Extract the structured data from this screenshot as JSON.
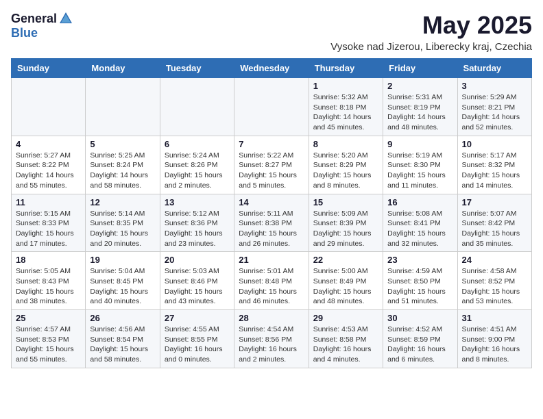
{
  "header": {
    "logo_general": "General",
    "logo_blue": "Blue",
    "month_title": "May 2025",
    "location": "Vysoke nad Jizerou, Liberecky kraj, Czechia"
  },
  "days_of_week": [
    "Sunday",
    "Monday",
    "Tuesday",
    "Wednesday",
    "Thursday",
    "Friday",
    "Saturday"
  ],
  "weeks": [
    [
      {
        "num": "",
        "detail": ""
      },
      {
        "num": "",
        "detail": ""
      },
      {
        "num": "",
        "detail": ""
      },
      {
        "num": "",
        "detail": ""
      },
      {
        "num": "1",
        "detail": "Sunrise: 5:32 AM\nSunset: 8:18 PM\nDaylight: 14 hours\nand 45 minutes."
      },
      {
        "num": "2",
        "detail": "Sunrise: 5:31 AM\nSunset: 8:19 PM\nDaylight: 14 hours\nand 48 minutes."
      },
      {
        "num": "3",
        "detail": "Sunrise: 5:29 AM\nSunset: 8:21 PM\nDaylight: 14 hours\nand 52 minutes."
      }
    ],
    [
      {
        "num": "4",
        "detail": "Sunrise: 5:27 AM\nSunset: 8:22 PM\nDaylight: 14 hours\nand 55 minutes."
      },
      {
        "num": "5",
        "detail": "Sunrise: 5:25 AM\nSunset: 8:24 PM\nDaylight: 14 hours\nand 58 minutes."
      },
      {
        "num": "6",
        "detail": "Sunrise: 5:24 AM\nSunset: 8:26 PM\nDaylight: 15 hours\nand 2 minutes."
      },
      {
        "num": "7",
        "detail": "Sunrise: 5:22 AM\nSunset: 8:27 PM\nDaylight: 15 hours\nand 5 minutes."
      },
      {
        "num": "8",
        "detail": "Sunrise: 5:20 AM\nSunset: 8:29 PM\nDaylight: 15 hours\nand 8 minutes."
      },
      {
        "num": "9",
        "detail": "Sunrise: 5:19 AM\nSunset: 8:30 PM\nDaylight: 15 hours\nand 11 minutes."
      },
      {
        "num": "10",
        "detail": "Sunrise: 5:17 AM\nSunset: 8:32 PM\nDaylight: 15 hours\nand 14 minutes."
      }
    ],
    [
      {
        "num": "11",
        "detail": "Sunrise: 5:15 AM\nSunset: 8:33 PM\nDaylight: 15 hours\nand 17 minutes."
      },
      {
        "num": "12",
        "detail": "Sunrise: 5:14 AM\nSunset: 8:35 PM\nDaylight: 15 hours\nand 20 minutes."
      },
      {
        "num": "13",
        "detail": "Sunrise: 5:12 AM\nSunset: 8:36 PM\nDaylight: 15 hours\nand 23 minutes."
      },
      {
        "num": "14",
        "detail": "Sunrise: 5:11 AM\nSunset: 8:38 PM\nDaylight: 15 hours\nand 26 minutes."
      },
      {
        "num": "15",
        "detail": "Sunrise: 5:09 AM\nSunset: 8:39 PM\nDaylight: 15 hours\nand 29 minutes."
      },
      {
        "num": "16",
        "detail": "Sunrise: 5:08 AM\nSunset: 8:41 PM\nDaylight: 15 hours\nand 32 minutes."
      },
      {
        "num": "17",
        "detail": "Sunrise: 5:07 AM\nSunset: 8:42 PM\nDaylight: 15 hours\nand 35 minutes."
      }
    ],
    [
      {
        "num": "18",
        "detail": "Sunrise: 5:05 AM\nSunset: 8:43 PM\nDaylight: 15 hours\nand 38 minutes."
      },
      {
        "num": "19",
        "detail": "Sunrise: 5:04 AM\nSunset: 8:45 PM\nDaylight: 15 hours\nand 40 minutes."
      },
      {
        "num": "20",
        "detail": "Sunrise: 5:03 AM\nSunset: 8:46 PM\nDaylight: 15 hours\nand 43 minutes."
      },
      {
        "num": "21",
        "detail": "Sunrise: 5:01 AM\nSunset: 8:48 PM\nDaylight: 15 hours\nand 46 minutes."
      },
      {
        "num": "22",
        "detail": "Sunrise: 5:00 AM\nSunset: 8:49 PM\nDaylight: 15 hours\nand 48 minutes."
      },
      {
        "num": "23",
        "detail": "Sunrise: 4:59 AM\nSunset: 8:50 PM\nDaylight: 15 hours\nand 51 minutes."
      },
      {
        "num": "24",
        "detail": "Sunrise: 4:58 AM\nSunset: 8:52 PM\nDaylight: 15 hours\nand 53 minutes."
      }
    ],
    [
      {
        "num": "25",
        "detail": "Sunrise: 4:57 AM\nSunset: 8:53 PM\nDaylight: 15 hours\nand 55 minutes."
      },
      {
        "num": "26",
        "detail": "Sunrise: 4:56 AM\nSunset: 8:54 PM\nDaylight: 15 hours\nand 58 minutes."
      },
      {
        "num": "27",
        "detail": "Sunrise: 4:55 AM\nSunset: 8:55 PM\nDaylight: 16 hours\nand 0 minutes."
      },
      {
        "num": "28",
        "detail": "Sunrise: 4:54 AM\nSunset: 8:56 PM\nDaylight: 16 hours\nand 2 minutes."
      },
      {
        "num": "29",
        "detail": "Sunrise: 4:53 AM\nSunset: 8:58 PM\nDaylight: 16 hours\nand 4 minutes."
      },
      {
        "num": "30",
        "detail": "Sunrise: 4:52 AM\nSunset: 8:59 PM\nDaylight: 16 hours\nand 6 minutes."
      },
      {
        "num": "31",
        "detail": "Sunrise: 4:51 AM\nSunset: 9:00 PM\nDaylight: 16 hours\nand 8 minutes."
      }
    ]
  ]
}
